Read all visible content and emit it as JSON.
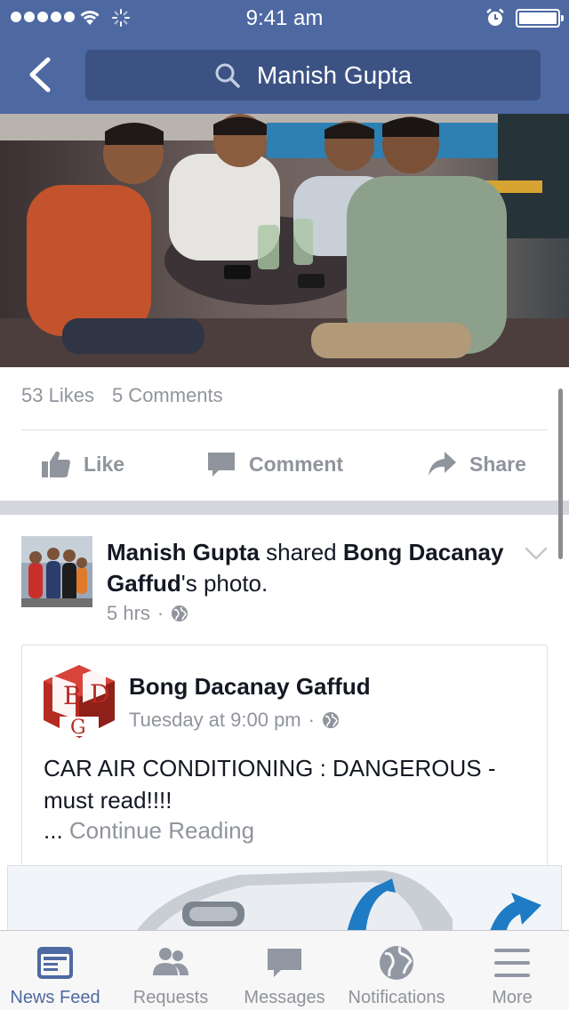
{
  "status_bar": {
    "time": "9:41 am",
    "signal_icon": "signal-dots-icon",
    "wifi_icon": "wifi-icon",
    "activity_icon": "loading-spinner-icon",
    "alarm_icon": "alarm-icon",
    "battery_icon": "battery-icon"
  },
  "nav": {
    "back_icon": "chevron-left-icon",
    "search_icon": "search-icon",
    "search_query": "Manish Gupta"
  },
  "post1": {
    "likes": "53 Likes",
    "comments": "5 Comments",
    "actions": {
      "like": "Like",
      "comment": "Comment",
      "share": "Share"
    }
  },
  "post2": {
    "author": "Manish Gupta",
    "verb": " shared ",
    "source": "Bong Dacanay Gaffud",
    "object": "'s photo.",
    "time": "5 hrs",
    "privacy_icon": "globe-icon",
    "shared": {
      "name": "Bong Dacanay Gaffud",
      "time": "Tuesday at 9:00 pm",
      "text": "CAR AIR CONDITIONING : DANGEROUS - must read!!!!",
      "ellipsis": "... ",
      "continue": "Continue Reading",
      "logo_letters": [
        "B",
        "D",
        "G"
      ]
    }
  },
  "tabs": [
    {
      "label": "News Feed",
      "icon": "news-feed-icon",
      "active": true
    },
    {
      "label": "Requests",
      "icon": "friend-requests-icon",
      "active": false
    },
    {
      "label": "Messages",
      "icon": "messages-icon",
      "active": false
    },
    {
      "label": "Notifications",
      "icon": "globe-icon",
      "active": false
    },
    {
      "label": "More",
      "icon": "menu-icon",
      "active": false
    }
  ],
  "colors": {
    "brand": "#4e69a2",
    "search_bg": "#3b5283",
    "muted": "#90949c",
    "text": "#141823"
  }
}
